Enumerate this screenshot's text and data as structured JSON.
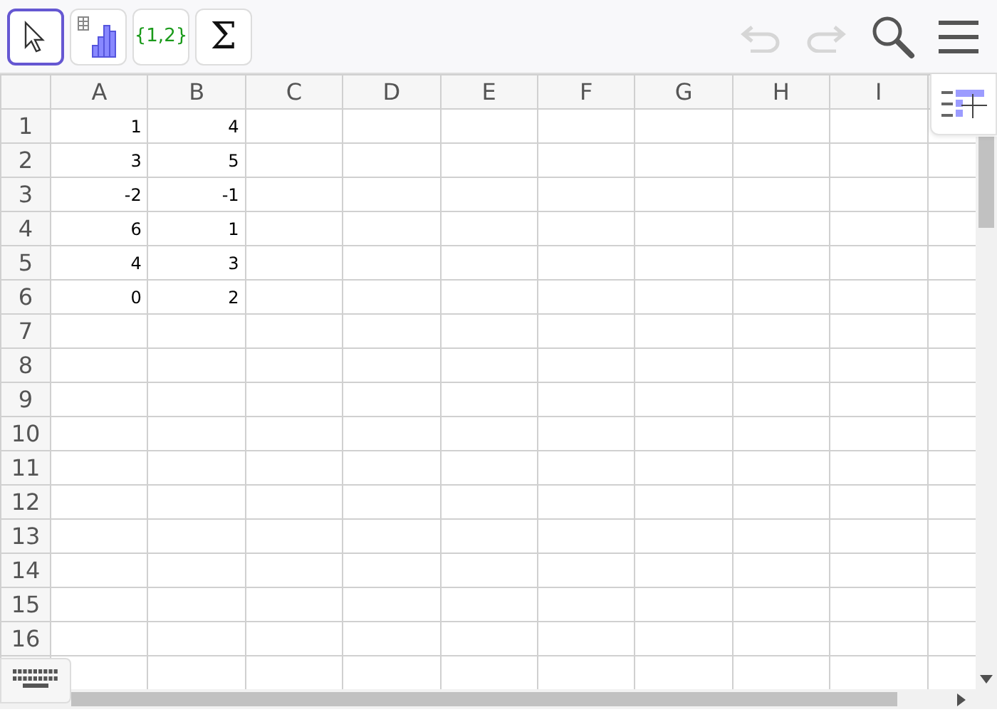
{
  "toolbar": {
    "tools": [
      {
        "kind": "move",
        "selected": true
      },
      {
        "kind": "chart",
        "selected": false
      },
      {
        "kind": "list",
        "label": "{1,2}",
        "selected": false
      },
      {
        "kind": "sum",
        "label": "Σ",
        "selected": false
      }
    ],
    "undo": {
      "disabled": true
    },
    "redo": {
      "disabled": true
    }
  },
  "spreadsheet": {
    "columns": [
      "A",
      "B",
      "C",
      "D",
      "E",
      "F",
      "G",
      "H",
      "I"
    ],
    "rows": [
      {
        "label": "1",
        "cells": [
          "1",
          "4"
        ]
      },
      {
        "label": "2",
        "cells": [
          "3",
          "5"
        ]
      },
      {
        "label": "3",
        "cells": [
          "-2",
          "-1"
        ]
      },
      {
        "label": "4",
        "cells": [
          "6",
          "1"
        ]
      },
      {
        "label": "5",
        "cells": [
          "4",
          "3"
        ]
      },
      {
        "label": "6",
        "cells": [
          "0",
          "2"
        ]
      },
      {
        "label": "7",
        "cells": []
      },
      {
        "label": "8",
        "cells": []
      },
      {
        "label": "9",
        "cells": []
      },
      {
        "label": "10",
        "cells": []
      },
      {
        "label": "11",
        "cells": []
      },
      {
        "label": "12",
        "cells": []
      },
      {
        "label": "13",
        "cells": []
      },
      {
        "label": "14",
        "cells": []
      },
      {
        "label": "15",
        "cells": []
      },
      {
        "label": "16",
        "cells": []
      }
    ]
  }
}
